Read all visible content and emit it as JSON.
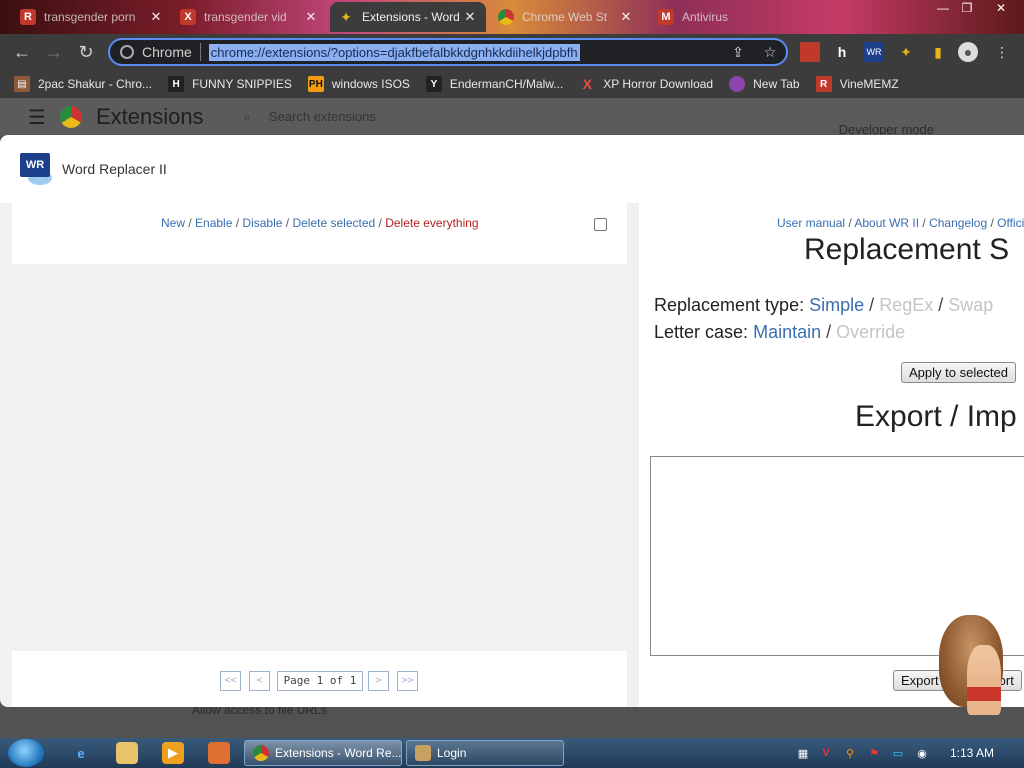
{
  "browser": {
    "tabs": [
      {
        "title": "transgender porn",
        "active": false
      },
      {
        "title": "transgender vid",
        "active": false
      },
      {
        "title": "Extensions - Word",
        "active": true
      },
      {
        "title": "Chrome Web St",
        "active": false
      },
      {
        "title": "Antivirus",
        "active": false
      }
    ],
    "omnibox_label": "Chrome",
    "url": "chrome://extensions/?options=djakfbefalbkkdgnhkkdiihelkjdpbfh",
    "bookmarks": [
      {
        "label": "2pac Shakur - Chro...",
        "color": "#c0392b"
      },
      {
        "label": "FUNNY SNIPPIES",
        "icon": "H",
        "color": "#333333"
      },
      {
        "label": "windows ISOS",
        "icon": "PH",
        "color": "#f39c12"
      },
      {
        "label": "EndermanCH/Malw...",
        "icon": "Y",
        "color": "#222222"
      },
      {
        "label": "XP Horror Download",
        "icon": "X",
        "color": "#e74c3c"
      },
      {
        "label": "New Tab",
        "color": "#8e44ad"
      },
      {
        "label": "VineMEMZ",
        "icon": "R",
        "color": "#c0392b"
      }
    ]
  },
  "extensions_page": {
    "title": "Extensions",
    "search_placeholder": "Search extensions",
    "developer_mode": "Developer mode",
    "file_urls": "Allow access to file URLs"
  },
  "dialog": {
    "title": "Word Replacer II",
    "logo_text": "WR",
    "actions": {
      "new": "New",
      "enable": "Enable",
      "disable": "Disable",
      "delete_selected": "Delete selected",
      "delete_everything": "Delete everything"
    },
    "pager": {
      "first": "<<",
      "prev": "<",
      "page_text": "Page 1 of 1",
      "next": ">",
      "last": ">>"
    },
    "right": {
      "links": {
        "manual": "User manual",
        "about": "About WR II",
        "changelog": "Changelog",
        "official": "Offici"
      },
      "settings_title": "Replacement S",
      "type_label": "Replacement type:",
      "type_simple": "Simple",
      "type_regex": "RegEx",
      "type_swap": "Swap",
      "case_label": "Letter case:",
      "case_maintain": "Maintain",
      "case_override": "Override",
      "apply_button": "Apply to selected",
      "export_title": "Export / Imp",
      "export_button": "Export",
      "import_button": "Import"
    }
  },
  "taskbar": {
    "tasks": [
      {
        "label": "Extensions - Word Re...",
        "active": true
      },
      {
        "label": "Login",
        "active": false
      }
    ],
    "clock": "1:13 AM"
  }
}
